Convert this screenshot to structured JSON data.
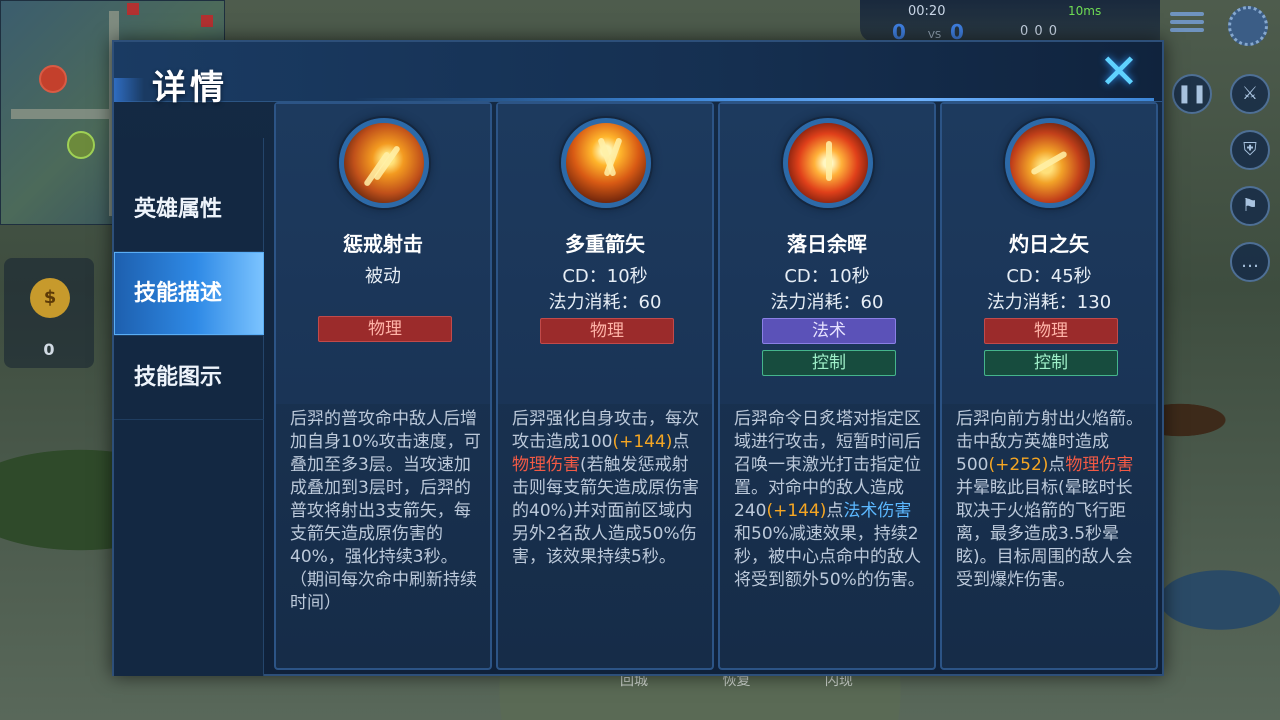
{
  "hud": {
    "time": "00:20",
    "ping": "10ms",
    "score_left": "0",
    "vs": "VS",
    "score_right": "0",
    "kda": "0 0 0",
    "gold": "0",
    "bottom_labels": [
      "回城",
      "恢复",
      "闪现"
    ]
  },
  "dialog": {
    "title": "详情",
    "close_label": "✕"
  },
  "sidebar": {
    "tabs": [
      {
        "label": "英雄属性",
        "active": false
      },
      {
        "label": "技能描述",
        "active": true
      },
      {
        "label": "技能图示",
        "active": false
      }
    ]
  },
  "skills": [
    {
      "name": "惩戒射击",
      "line1": "被动",
      "line2": "",
      "tags": [
        {
          "label": "物理",
          "kind": "phys"
        }
      ],
      "desc": [
        {
          "t": "后羿的普攻命中敌人后增加自身10%攻击速度，可叠加至多3层。当攻速加成叠加到3层时，后羿的普攻将射出3支箭矢，每支箭矢造成原伤害的40%，强化持续3秒。（期间每次命中刷新持续时间）"
        }
      ]
    },
    {
      "name": "多重箭矢",
      "line1": "CD：10秒",
      "line2": "法力消耗：60",
      "tags": [
        {
          "label": "物理",
          "kind": "phys"
        }
      ],
      "desc": [
        {
          "t": "后羿强化自身攻击，每次攻击造成100"
        },
        {
          "t": "(+144)",
          "c": "orange"
        },
        {
          "t": "点"
        },
        {
          "t": "物理伤害",
          "c": "red"
        },
        {
          "t": "(若触发惩戒射击则每支箭矢造成原伤害的40%)并对面前区域内另外2名敌人造成50%伤害，该效果持续5秒。"
        }
      ]
    },
    {
      "name": "落日余晖",
      "line1": "CD：10秒",
      "line2": "法力消耗：60",
      "tags": [
        {
          "label": "法术",
          "kind": "magic"
        },
        {
          "label": "控制",
          "kind": "ctrl"
        }
      ],
      "desc": [
        {
          "t": "后羿命令日炙塔对指定区域进行攻击，短暂时间后召唤一束激光打击指定位置。对命中的敌人造成240"
        },
        {
          "t": "(+144)",
          "c": "orange"
        },
        {
          "t": "点"
        },
        {
          "t": "法术伤害",
          "c": "blue"
        },
        {
          "t": "和50%减速效果，持续2秒，被中心点命中的敌人将受到额外50%的伤害。"
        }
      ]
    },
    {
      "name": "灼日之矢",
      "line1": "CD：45秒",
      "line2": "法力消耗：130",
      "tags": [
        {
          "label": "物理",
          "kind": "phys"
        },
        {
          "label": "控制",
          "kind": "ctrl"
        }
      ],
      "desc": [
        {
          "t": "后羿向前方射出火焰箭。击中敌方英雄时造成500"
        },
        {
          "t": "(+252)",
          "c": "orange"
        },
        {
          "t": "点"
        },
        {
          "t": "物理伤害",
          "c": "red"
        },
        {
          "t": "并晕眩此目标(晕眩时长取决于火焰箭的飞行距离，最多造成3.5秒晕眩)。目标周围的敌人会受到爆炸伤害。"
        }
      ]
    }
  ]
}
